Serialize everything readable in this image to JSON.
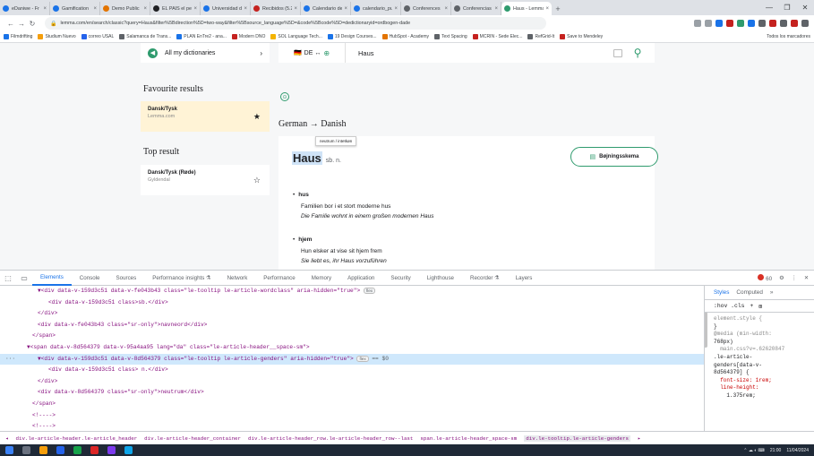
{
  "browser": {
    "tabs": [
      {
        "label": "eDaniwe - Fr",
        "color": "#1a73e8"
      },
      {
        "label": "Gamification",
        "color": "#1a73e8"
      },
      {
        "label": "Demo Public",
        "color": "#e37400"
      },
      {
        "label": "EL PAÍS el per",
        "color": "#202124"
      },
      {
        "label": "Universidad de",
        "color": "#1a73e8"
      },
      {
        "label": "Recibidos (5.2",
        "color": "#c5221f"
      },
      {
        "label": "Calendario de",
        "color": "#1a73e8"
      },
      {
        "label": "calendario_pu",
        "color": "#1a73e8"
      },
      {
        "label": "Conferences",
        "color": "#5f6368"
      },
      {
        "label": "Conferencias",
        "color": "#5f6368"
      },
      {
        "label": "Haus - Lemma",
        "color": "#2f9b6e"
      }
    ],
    "url": "lemma.com/en/search/classic?query=Haus&filter%5Bdirection%5D=two-way&filter%5Bsource_language%5D=&code%5Bcode%5D=dedictionaryid=ordbogen-dade",
    "bookmarks": [
      "Filmdrifting",
      "Studium Nuevo",
      "correo USAL",
      "Salamanca de Trans...",
      "PLAN EnTre2 - ana...",
      "Modern DNO",
      "SOL Language Tech...",
      "19 Design Courses...",
      "HubSpot - Academy",
      "Text Spacing",
      "MCRIN - Sede Elec...",
      "RefGrid-It",
      "Save to Mendeley"
    ],
    "bookmarks_right": "Todos los marcadores"
  },
  "page": {
    "dictionaries_label": "All my dictionaries",
    "lang_pair": "DE ↔",
    "search_value": "Haus",
    "favourite_title": "Favourite results",
    "favourite": {
      "title": "Dansk/Tysk",
      "subtitle": "Lemma.com"
    },
    "top_title": "Top result",
    "top": {
      "title": "Dansk/Tysk (Røde)",
      "subtitle": "Gyldendal"
    },
    "direction_from": "German",
    "direction_arrow": "→",
    "direction_to": "Danish",
    "tooltip": "neutrum / intetkøn",
    "headword": "Haus",
    "grammar": "sb. n.",
    "inflection_button": "Bøjningsskema",
    "senses": [
      {
        "head": "hus",
        "ex_da": "Familien bor i et stort moderne hus",
        "ex_de": "Die Familie wohnt in einem großen modernen Haus"
      },
      {
        "head": "hjem",
        "ex_da": "Hun elsker at vise sit hjem frem",
        "ex_de": "Sie liebt es, ihr Haus vorzuführen"
      }
    ]
  },
  "devtools": {
    "tabs": [
      "Elements",
      "Console",
      "Sources",
      "Performance insights ⚗",
      "Network",
      "Performance",
      "Memory",
      "Application",
      "Security",
      "Lighthouse",
      "Recorder ⚗",
      "Layers"
    ],
    "active_tab": "Elements",
    "issues_count": "60",
    "code": [
      {
        "indent": 6,
        "text": "▼<div data-v-159d3c51 data-v-fe043b43 class=\"le-tooltip le-article-wordclass\" aria-hidden=\"true\">",
        "badge": "flex"
      },
      {
        "indent": 8,
        "text": "<div data-v-159d3c51 class>sb.</div>"
      },
      {
        "indent": 6,
        "text": "</div>"
      },
      {
        "indent": 6,
        "text": "<div data-v-fe043b43 class=\"sr-only\">navneord</div>"
      },
      {
        "indent": 5,
        "text": "</span>"
      },
      {
        "indent": 4,
        "text": "▼<span data-v-8d564379 data-v-95a4aa95 lang=\"da\" class=\"le-article-header__space-sm\">"
      },
      {
        "indent": 6,
        "text": "▼<div data-v-159d3c51 data-v-8d564379 class=\"le-tooltip le-article-genders\" aria-hidden=\"true\">",
        "badge": "flex",
        "selected": true
      },
      {
        "indent": 8,
        "text": "<div data-v-159d3c51 class> n.</div>"
      },
      {
        "indent": 6,
        "text": "</div>"
      },
      {
        "indent": 6,
        "text": "<div data-v-8d564379 class=\"sr-only\">neutrum</div>"
      },
      {
        "indent": 5,
        "text": "</span>"
      },
      {
        "indent": 5,
        "text": "<!---->"
      },
      {
        "indent": 5,
        "text": "<!---->"
      }
    ],
    "selected_marker": "== $0",
    "breadcrumbs": [
      "div.le-article-header.le-article_header",
      "div.le-article-header_container",
      "div.le-article-header_row.le-article-header_row--last",
      "span.le-article-header_space-sm",
      "div.le-tooltip.le-article-genders"
    ],
    "styles_tabs": [
      "Styles",
      "Computed",
      "»"
    ],
    "styles_filter": ":hov .cls",
    "styles_lines": [
      {
        "text": "element.style {",
        "cls": "grey"
      },
      {
        "text": "}",
        "cls": ""
      },
      {
        "text": "@media (min-width:",
        "cls": "grey"
      },
      {
        "text": "768px)",
        "cls": ""
      },
      {
        "text": "  main.css?v=.62620847",
        "cls": "grey"
      },
      {
        "text": ".le-article-",
        "cls": ""
      },
      {
        "text": "genders[data-v-",
        "cls": ""
      },
      {
        "text": "8d564379] {",
        "cls": ""
      },
      {
        "text": "  font-size: 1rem;",
        "cls": "prop"
      },
      {
        "text": "  line-height:",
        "cls": "prop"
      },
      {
        "text": "    1.375rem;",
        "cls": ""
      }
    ]
  },
  "taskbar": {
    "time": "21:00",
    "date": "11/04/2024"
  }
}
